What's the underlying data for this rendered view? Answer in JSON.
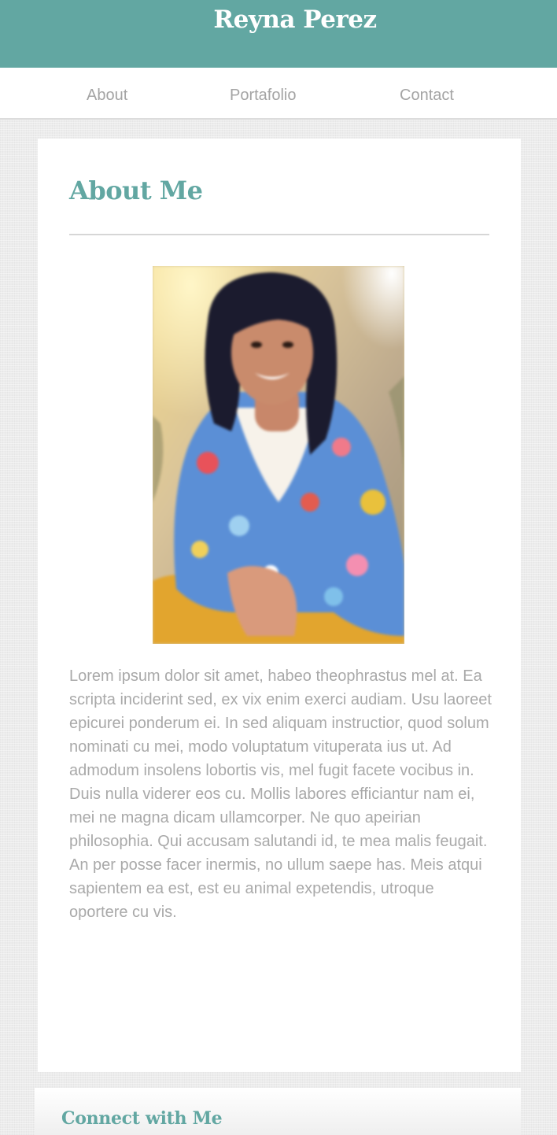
{
  "header": {
    "title": "Reyna Perez",
    "background_color": "#62a7a2"
  },
  "nav": {
    "items": [
      {
        "label": "About"
      },
      {
        "label": "Portafolio"
      },
      {
        "label": "Contact"
      }
    ]
  },
  "about": {
    "heading": "About Me",
    "photo_icon": "portrait-photo",
    "bio": "Lorem ipsum dolor sit amet, habeo theophrastus mel at. Ea scripta inciderint sed, ex vix enim exerci audiam. Usu laoreet epicurei ponderum ei. In sed aliquam instructior, quod solum nominati cu mei, modo voluptatum vituperata ius ut. Ad admodum insolens lobortis vis, mel fugit facete vocibus in. Duis nulla viderer eos cu. Mollis labores efficiantur nam ei, mei ne magna dicam ullamcorper. Ne quo apeirian philosophia. Qui accusam salutandi id, te mea malis feugait. An per posse facer inermis, no ullum saepe has. Meis atqui sapientem ea est, est eu animal expetendis, utroque oportere cu vis."
  },
  "connect": {
    "heading": "Connect with Me"
  },
  "colors": {
    "accent": "#62a7a2",
    "nav_text": "#a4a4a4",
    "body_text": "#a9a9a9",
    "page_background": "#ececec"
  }
}
